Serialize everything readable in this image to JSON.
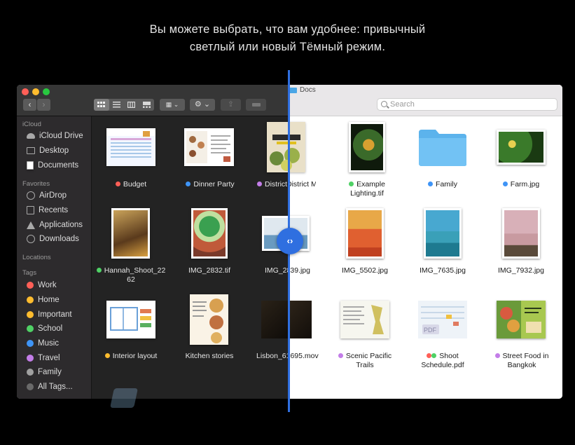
{
  "caption": {
    "line1": "Вы можете выбрать, что вам удобнее: привычный",
    "line2": "светлый или новый Тёмный режим."
  },
  "window": {
    "folder_title": "Docs",
    "search_placeholder": "Search"
  },
  "toolbar": {
    "back_icon": "chevron-left-icon",
    "forward_icon": "chevron-right-icon",
    "view_modes": [
      "icon-view-icon",
      "list-view-icon",
      "column-view-icon",
      "gallery-view-icon"
    ],
    "group_icon": "group-by-icon",
    "action_icon": "gear-icon",
    "share_icon": "share-icon",
    "tag_icon": "tag-icon"
  },
  "sidebar": {
    "sections": {
      "icloud": "iCloud",
      "favorites": "Favorites",
      "locations": "Locations",
      "tags": "Tags"
    },
    "icloud_items": [
      {
        "label": "iCloud Drive",
        "icon": "cloud-icon"
      },
      {
        "label": "Desktop",
        "icon": "desktop-icon"
      },
      {
        "label": "Documents",
        "icon": "document-icon"
      }
    ],
    "favorites_items": [
      {
        "label": "AirDrop",
        "icon": "airdrop-icon"
      },
      {
        "label": "Recents",
        "icon": "recents-icon"
      },
      {
        "label": "Applications",
        "icon": "applications-icon"
      },
      {
        "label": "Downloads",
        "icon": "downloads-icon"
      }
    ],
    "tags": [
      {
        "label": "Work",
        "color": "#ff5f57"
      },
      {
        "label": "Home",
        "color": "#febc2e"
      },
      {
        "label": "Important",
        "color": "#febc2e"
      },
      {
        "label": "School",
        "color": "#4fd165"
      },
      {
        "label": "Music",
        "color": "#3e94f6"
      },
      {
        "label": "Travel",
        "color": "#c37de8"
      },
      {
        "label": "Family",
        "color": "#a0a0a0"
      },
      {
        "label": "All Tags...",
        "color": "#6a6a6a"
      }
    ]
  },
  "files": [
    {
      "label": "Budget",
      "tag": "#ff5f57"
    },
    {
      "label": "Dinner Party",
      "tag": "#3e94f6"
    },
    {
      "label": "District Market",
      "tag": "#c37de8"
    },
    {
      "label": "Example",
      "label2": "Lighting.tif",
      "tag": "#4fd165"
    },
    {
      "label": "Family",
      "tag": "#3e94f6"
    },
    {
      "label": "Farm.jpg",
      "tag": "#3e94f6"
    },
    {
      "label": "Hannah_Shoot_22",
      "label2": "62",
      "tag": "#4fd165"
    },
    {
      "label": "IMG_2832.tif"
    },
    {
      "label": "IMG_2839.jpg"
    },
    {
      "label": "IMG_5502.jpg"
    },
    {
      "label": "IMG_7635.jpg"
    },
    {
      "label": "IMG_7932.jpg"
    },
    {
      "label": "Interior layout",
      "tag": "#febc2e"
    },
    {
      "label": "Kitchen stories"
    },
    {
      "label": "Lisbon_61695.mov"
    },
    {
      "label": "Scenic Pacific",
      "label2": "Trails",
      "tag": "#c37de8"
    },
    {
      "label": "Shoot",
      "label2": "Schedule.pdf",
      "tag": "#4fd165"
    },
    {
      "label": "Street Food in",
      "label2": "Bangkok",
      "tag": "#c37de8"
    }
  ],
  "divider": {
    "icon": "‹›"
  },
  "colors": {
    "accent": "#2f6fe0",
    "dark_bg": "#232323",
    "sidebar_bg": "#2d2b2d"
  }
}
